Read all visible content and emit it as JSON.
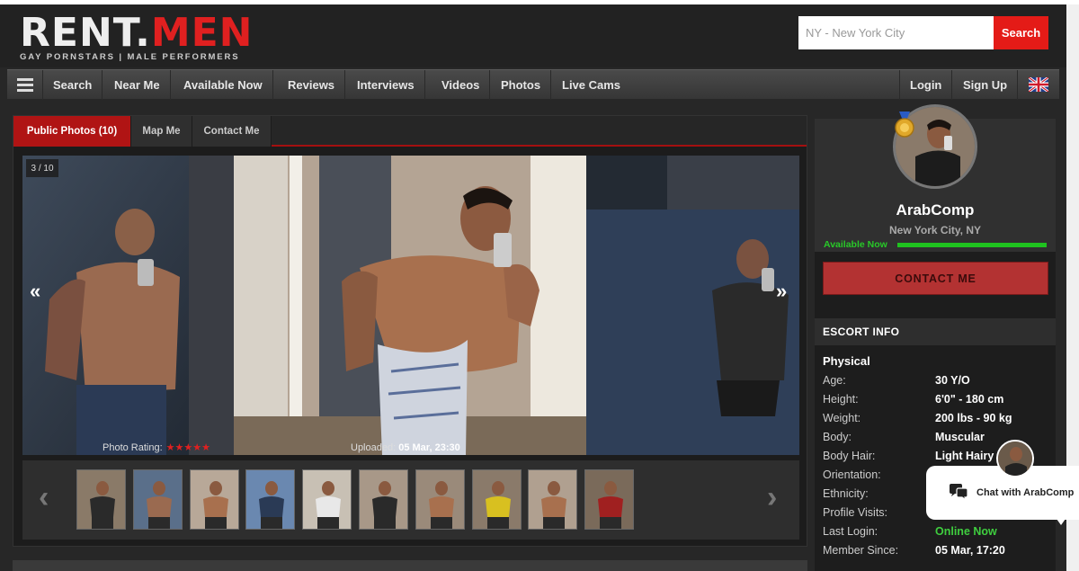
{
  "header": {
    "logo_part1": "RENT.",
    "logo_part2": "MEN",
    "tagline": "GAY PORNSTARS | MALE PERFORMERS",
    "search_placeholder": "NY - New York City",
    "search_button": "Search"
  },
  "nav": {
    "items": [
      "Search",
      "Near Me",
      "Available Now",
      "Reviews",
      "Interviews",
      "Videos",
      "Photos",
      "Live Cams"
    ],
    "login": "Login",
    "signup": "Sign Up"
  },
  "tabs": [
    "Public Photos (10)",
    "Map Me",
    "Contact Me"
  ],
  "gallery": {
    "counter": "3 / 10",
    "prev": "«",
    "next": "»",
    "rating_label": "Photo Rating:",
    "rating_stars": "★★★★★",
    "uploaded_label": "Uploaded:",
    "uploaded_value": "05 Mar, 23:30",
    "thumb_count": 10,
    "thumb_prev": "‹",
    "thumb_next": "›"
  },
  "profile": {
    "name": "ArabComp",
    "location": "New York City, NY",
    "status": "Available Now",
    "contact_button": "CONTACT ME"
  },
  "escort_info": {
    "heading": "ESCORT INFO",
    "section": "Physical",
    "rows": [
      {
        "k": "Age:",
        "v": "30 Y/O"
      },
      {
        "k": "Height:",
        "v": "6'0\" - 180 cm"
      },
      {
        "k": "Weight:",
        "v": "200 lbs - 90 kg"
      },
      {
        "k": "Body:",
        "v": "Muscular"
      },
      {
        "k": "Body Hair:",
        "v": "Light Hairy"
      },
      {
        "k": "Orientation:",
        "v": ""
      },
      {
        "k": "Ethnicity:",
        "v": ""
      },
      {
        "k": "Profile Visits:",
        "v": ""
      },
      {
        "k": "Last Login:",
        "v": "Online Now"
      },
      {
        "k": "Member Since:",
        "v": "05 Mar, 17:20"
      }
    ]
  },
  "chat": {
    "label": "Chat with ArabComp"
  },
  "colors": {
    "accent_red": "#e41b17",
    "tab_active": "#b01414",
    "available_green": "#1fc21f",
    "contact_button": "#b33232"
  }
}
